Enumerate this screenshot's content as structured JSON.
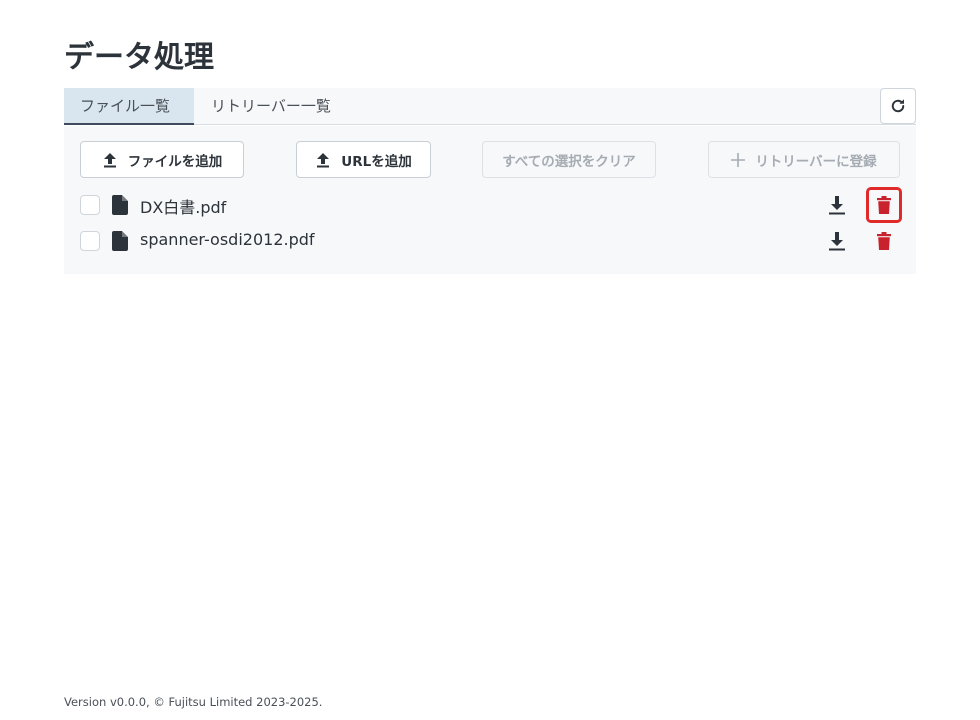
{
  "page": {
    "title": "データ処理"
  },
  "tabs": [
    {
      "label": "ファイル一覧",
      "active": true
    },
    {
      "label": "リトリーバー一覧",
      "active": false
    }
  ],
  "toolbar": {
    "add_file_label": "ファイルを追加",
    "add_url_label": "URLを追加",
    "clear_selection_label": "すべての選択をクリア",
    "register_retriever_label": "リトリーバーに登録"
  },
  "files": [
    {
      "name": "DX白書.pdf",
      "checked": false
    },
    {
      "name": "spanner-osdi2012.pdf",
      "checked": false
    }
  ],
  "icons": {
    "refresh": "refresh-icon",
    "upload": "upload-icon",
    "plus": "plus-icon",
    "file": "file-icon",
    "download": "download-icon",
    "trash": "trash-icon"
  },
  "colors": {
    "delete": "#c8232c",
    "highlight": "#e02a2a",
    "active_tab_bg": "#d9e6ef"
  },
  "footer": {
    "text": "Version v0.0.0, © Fujitsu Limited 2023-2025."
  }
}
